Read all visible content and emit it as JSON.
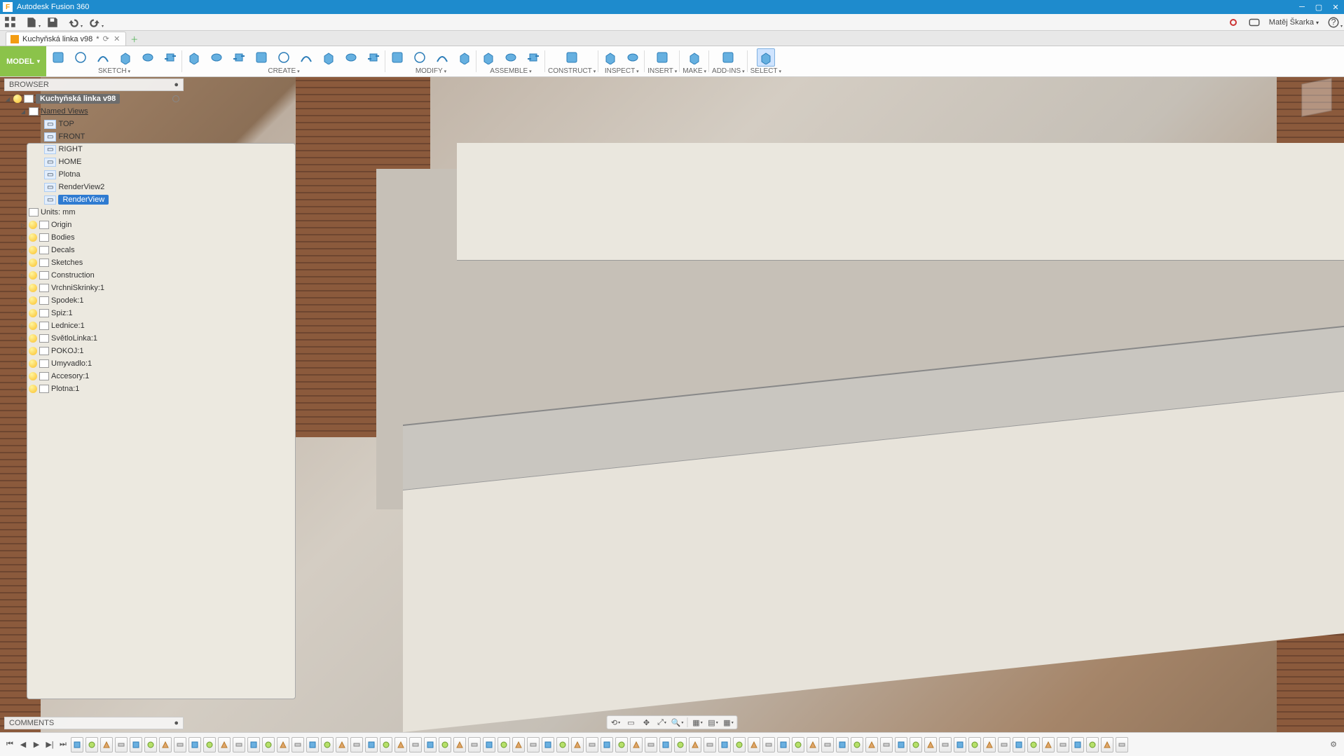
{
  "app_title": "Autodesk Fusion 360",
  "user_name": "Matěj Škarka",
  "tab": {
    "name": "Kuchyňská linka v98",
    "dirty": "*"
  },
  "workspace": "MODEL",
  "ribbon_groups": [
    {
      "id": "sketch",
      "label": "SKETCH",
      "icons": 6
    },
    {
      "id": "create",
      "label": "CREATE",
      "icons": 9
    },
    {
      "id": "modify",
      "label": "MODIFY",
      "icons": 4
    },
    {
      "id": "assemble",
      "label": "ASSEMBLE",
      "icons": 3
    },
    {
      "id": "construct",
      "label": "CONSTRUCT",
      "icons": 1
    },
    {
      "id": "inspect",
      "label": "INSPECT",
      "icons": 2
    },
    {
      "id": "insert",
      "label": "INSERT",
      "icons": 1
    },
    {
      "id": "make",
      "label": "MAKE",
      "icons": 1
    },
    {
      "id": "addins",
      "label": "ADD-INS",
      "icons": 1
    },
    {
      "id": "select",
      "label": "SELECT",
      "icons": 1,
      "selected": true
    }
  ],
  "browser_title": "BROWSER",
  "comments_title": "COMMENTS",
  "tree": {
    "root": "Kuchyňská linka v98",
    "named_views_label": "Named Views",
    "views": [
      "TOP",
      "FRONT",
      "RIGHT",
      "HOME",
      "Plotna",
      "RenderView2",
      "RenderView"
    ],
    "selected_view": "RenderView",
    "units": "Units: mm",
    "items": [
      "Origin",
      "Bodies",
      "Decals",
      "Sketches",
      "Construction",
      "VrchniSkrinky:1",
      "Spodek:1",
      "Spiz:1",
      "Lednice:1",
      "SvětloLinka:1",
      "POKOJ:1",
      "Umyvadlo:1",
      "Accesory:1",
      "Plotna:1"
    ]
  },
  "timeline_count": 72
}
